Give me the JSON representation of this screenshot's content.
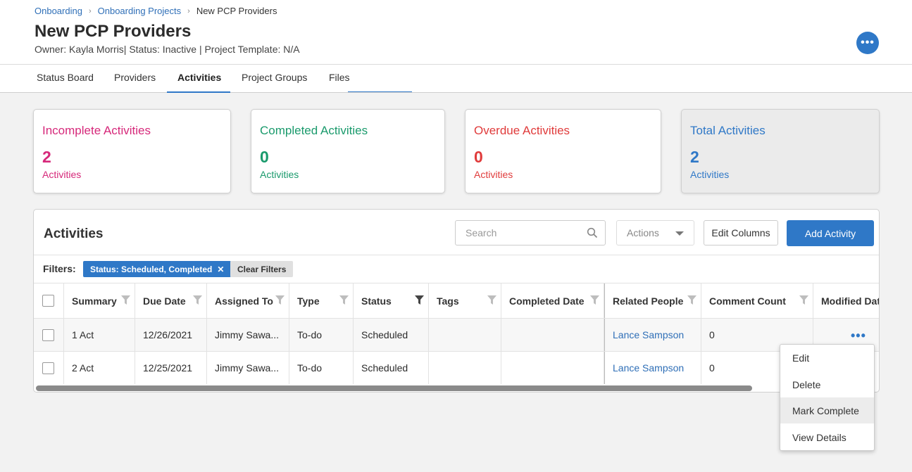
{
  "breadcrumb": {
    "items": [
      "Onboarding",
      "Onboarding Projects",
      "New PCP Providers"
    ]
  },
  "page": {
    "title": "New PCP Providers",
    "subtitle": "Owner: Kayla Morris| Status: Inactive | Project Template: N/A"
  },
  "tabs": [
    "Status Board",
    "Providers",
    "Activities",
    "Project Groups",
    "Files"
  ],
  "active_tab": "Activities",
  "colors": {
    "accent": "#2f78c7",
    "incomplete": "#d6287a",
    "completed": "#1a9a6c",
    "overdue": "#e03b3b",
    "total": "#2f78c7"
  },
  "cards": [
    {
      "title": "Incomplete Activities",
      "count": "2",
      "unit": "Activities"
    },
    {
      "title": "Completed Activities",
      "count": "0",
      "unit": "Activities"
    },
    {
      "title": "Overdue Activities",
      "count": "0",
      "unit": "Activities"
    },
    {
      "title": "Total Activities",
      "count": "2",
      "unit": "Activities"
    }
  ],
  "panel": {
    "title": "Activities",
    "search_placeholder": "Search",
    "actions_label": "Actions",
    "edit_columns_label": "Edit Columns",
    "add_activity_label": "Add Activity"
  },
  "filters": {
    "label": "Filters:",
    "chip": "Status: Scheduled, Completed",
    "clear_label": "Clear Filters"
  },
  "table": {
    "columns": [
      "Summary",
      "Due Date",
      "Assigned To",
      "Type",
      "Status",
      "Tags",
      "Completed Date",
      "Related People",
      "Comment Count",
      "Modified Dat"
    ],
    "rows": [
      [
        "1 Act",
        "12/26/2021",
        "Jimmy Sawa...",
        "To-do",
        "Scheduled",
        "",
        "",
        "Lance Sampson",
        "0",
        ""
      ],
      [
        "2 Act",
        "12/25/2021",
        "Jimmy Sawa...",
        "To-do",
        "Scheduled",
        "",
        "",
        "Lance Sampson",
        "0",
        ""
      ]
    ]
  },
  "row_menu": {
    "items": [
      "Edit",
      "Delete",
      "Mark Complete",
      "View Details"
    ],
    "highlighted": "Mark Complete"
  }
}
